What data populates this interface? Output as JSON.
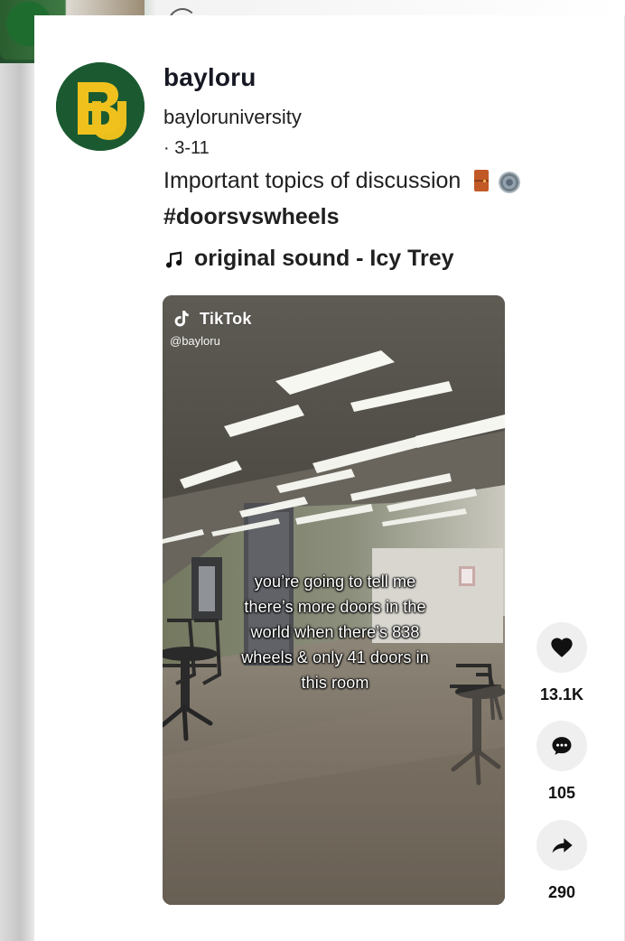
{
  "profile": {
    "username": "bayloru",
    "handle": "bayloruniversity",
    "date": "· 3-11",
    "avatar_initials": "BU"
  },
  "post": {
    "caption": "Important topics of discussion",
    "hashtag": "#doorsvswheels",
    "sound": "original sound - Icy Trey"
  },
  "video": {
    "watermark_brand": "TikTok",
    "watermark_handle": "@bayloru",
    "overlay_lines": [
      "you’re going to tell me",
      "there’s more doors in the",
      "world when there’s 838",
      "wheels & only 41 doors in",
      "this room"
    ]
  },
  "actions": {
    "like_count": "13.1K",
    "comment_count": "105",
    "share_count": "290"
  },
  "icons": {
    "avatar": "baylor-logo-icon",
    "caption_1": "door-icon",
    "caption_2": "gear-icon",
    "sound": "music-note-icon",
    "watermark": "tiktok-logo-icon",
    "like": "heart-icon",
    "comment": "comment-icon",
    "share": "share-icon"
  },
  "colors": {
    "page_bg": "#ffffff",
    "text_primary": "#161823",
    "action_bg": "#efefef",
    "baylor_green": "#1b5a31",
    "baylor_gold": "#f0c11d"
  }
}
